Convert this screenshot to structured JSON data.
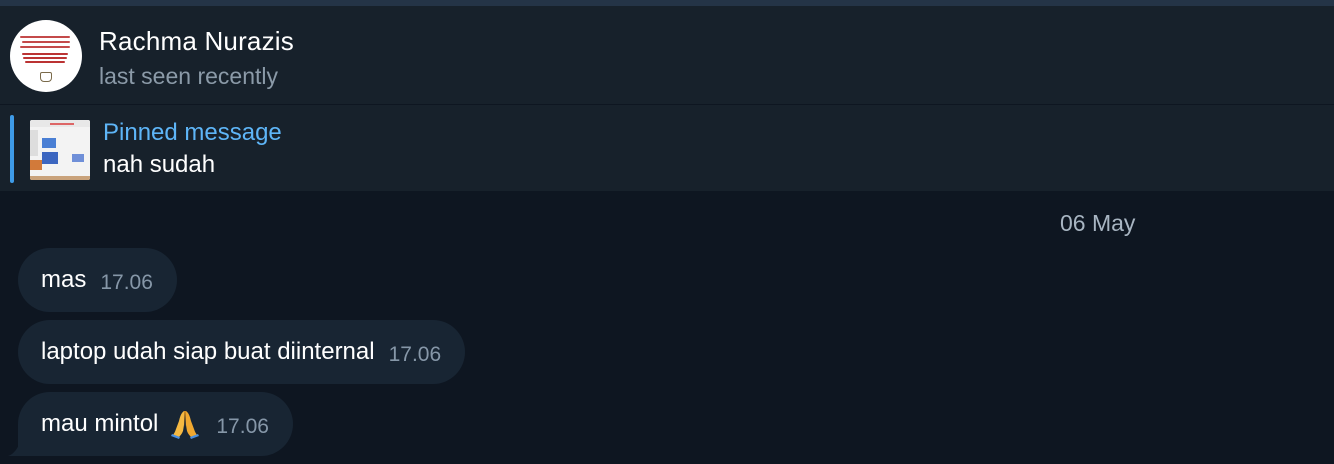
{
  "header": {
    "contact_name": "Rachma Nurazis",
    "status": "last seen recently"
  },
  "pinned": {
    "title": "Pinned message",
    "text": "nah sudah"
  },
  "chat": {
    "date_separator": "06 May",
    "messages": [
      {
        "text": "mas",
        "time": "17.06",
        "emoji": ""
      },
      {
        "text": "laptop udah siap buat diinternal",
        "time": "17.06",
        "emoji": ""
      },
      {
        "text": "mau mintol",
        "time": "17.06",
        "emoji": "folded-hands"
      }
    ]
  },
  "colors": {
    "accent": "#5eb5f7",
    "bubble": "#182533",
    "background": "#0e1621",
    "header": "#17212b"
  }
}
